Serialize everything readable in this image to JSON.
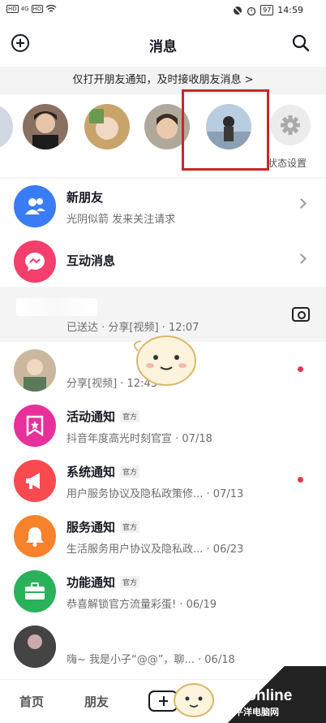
{
  "status_bar": {
    "left_badge_1": "HD",
    "left_badge_2": "HD",
    "network": "4G",
    "battery": "97",
    "time": "14:59"
  },
  "header": {
    "title": "消息"
  },
  "notice": {
    "text": "仅打开朋友通知，及时接收朋友消息 >"
  },
  "stories": {
    "status_setting_label": "状态设置"
  },
  "rows": [
    {
      "name": "新朋友",
      "desc": "光阴似箭 发来关注请求",
      "icon": "users-icon",
      "color": "#3a7cf5"
    },
    {
      "name": "互动消息",
      "desc": "",
      "icon": "chat-bubble-icon",
      "color": "#f43e6c"
    },
    {
      "name": "",
      "desc": "已送达 · 分享[视频] · 12:07",
      "icon": "camera-icon"
    },
    {
      "name": "",
      "desc": "分享[视频] · 12:43 ·",
      "icon": "avatar"
    },
    {
      "name": "活动通知",
      "badge": "官方",
      "desc": "抖音年度高光时刻官宣 · 07/18",
      "icon": "bookmark-star-icon",
      "color": "#e8309b"
    },
    {
      "name": "系统通知",
      "badge": "官方",
      "desc": "用户服务协议及隐私政策修... · 07/13",
      "icon": "megaphone-icon",
      "color": "#f84a4f"
    },
    {
      "name": "服务通知",
      "badge": "官方",
      "desc": "生活服务用户协议及隐私政... · 06/23",
      "icon": "bell-icon",
      "color": "#f7822b"
    },
    {
      "name": "功能通知",
      "badge": "官方",
      "desc": "恭喜解锁官方流量彩蛋! · 06/19",
      "icon": "briefcase-icon",
      "color": "#29b25a"
    },
    {
      "name": "",
      "desc": "嗨~ 我是小子“@@”，聊... · 06/18",
      "icon": "avatar"
    }
  ],
  "bottom_nav": {
    "home": "首页",
    "friends": "朋友"
  },
  "watermark": {
    "brand": "PConline",
    "sub": "太平洋电脑网"
  },
  "colors": {
    "highlight": "#c62828",
    "unread_dot": "#e8374e"
  }
}
